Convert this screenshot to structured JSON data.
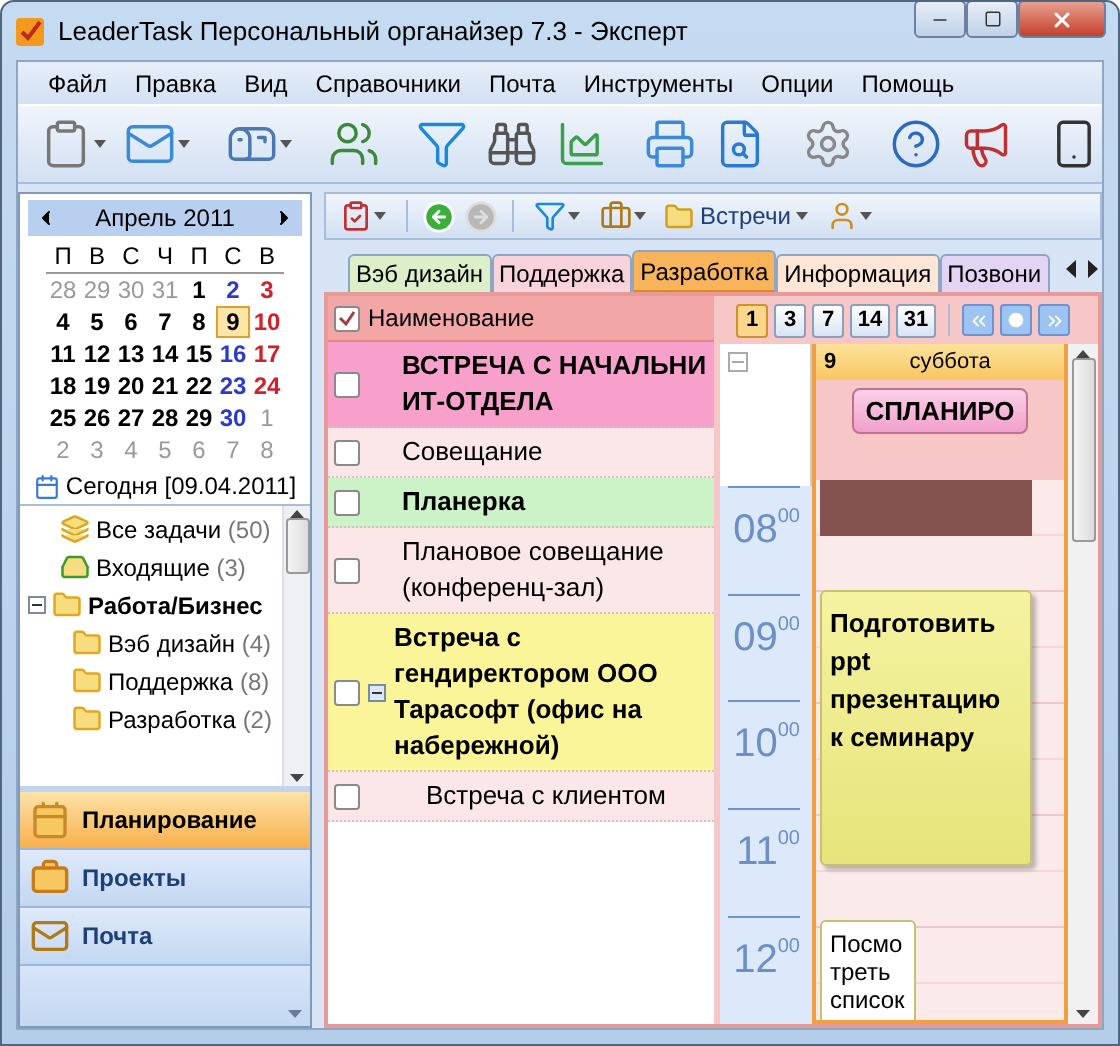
{
  "window": {
    "title": "LeaderTask Персональный органайзер 7.3 - Эксперт"
  },
  "menu": [
    "Файл",
    "Правка",
    "Вид",
    "Справочники",
    "Почта",
    "Инструменты",
    "Опции",
    "Помощь"
  ],
  "calendar": {
    "month": "Апрель 2011",
    "weekdays": [
      "П",
      "В",
      "С",
      "Ч",
      "П",
      "С",
      "В"
    ],
    "weeks": [
      [
        {
          "day": "28",
          "kind": "other",
          "selected": false
        },
        {
          "day": "29",
          "kind": "other",
          "selected": false
        },
        {
          "day": "30",
          "kind": "other",
          "selected": false
        },
        {
          "day": "31",
          "kind": "other",
          "selected": false
        },
        {
          "day": "1",
          "kind": "weekday",
          "selected": false
        },
        {
          "day": "2",
          "kind": "saturday",
          "selected": false
        },
        {
          "day": "3",
          "kind": "sunday",
          "selected": false
        }
      ],
      [
        {
          "day": "4",
          "kind": "weekday",
          "selected": false
        },
        {
          "day": "5",
          "kind": "weekday",
          "selected": false
        },
        {
          "day": "6",
          "kind": "weekday",
          "selected": false
        },
        {
          "day": "7",
          "kind": "weekday",
          "selected": false
        },
        {
          "day": "8",
          "kind": "weekday",
          "selected": false
        },
        {
          "day": "9",
          "kind": "saturday",
          "selected": true
        },
        {
          "day": "10",
          "kind": "sunday",
          "selected": false
        }
      ],
      [
        {
          "day": "11",
          "kind": "weekday",
          "selected": false
        },
        {
          "day": "12",
          "kind": "weekday",
          "selected": false
        },
        {
          "day": "13",
          "kind": "weekday",
          "selected": false
        },
        {
          "day": "14",
          "kind": "weekday",
          "selected": false
        },
        {
          "day": "15",
          "kind": "weekday",
          "selected": false
        },
        {
          "day": "16",
          "kind": "saturday",
          "selected": false
        },
        {
          "day": "17",
          "kind": "sunday",
          "selected": false
        }
      ],
      [
        {
          "day": "18",
          "kind": "weekday",
          "selected": false
        },
        {
          "day": "19",
          "kind": "weekday",
          "selected": false
        },
        {
          "day": "20",
          "kind": "weekday",
          "selected": false
        },
        {
          "day": "21",
          "kind": "weekday",
          "selected": false
        },
        {
          "day": "22",
          "kind": "weekday",
          "selected": false
        },
        {
          "day": "23",
          "kind": "saturday",
          "selected": false
        },
        {
          "day": "24",
          "kind": "sunday",
          "selected": false
        }
      ],
      [
        {
          "day": "25",
          "kind": "weekday",
          "selected": false
        },
        {
          "day": "26",
          "kind": "weekday",
          "selected": false
        },
        {
          "day": "27",
          "kind": "weekday",
          "selected": false
        },
        {
          "day": "28",
          "kind": "weekday",
          "selected": false
        },
        {
          "day": "29",
          "kind": "weekday",
          "selected": false
        },
        {
          "day": "30",
          "kind": "saturday",
          "selected": false
        },
        {
          "day": "1",
          "kind": "other",
          "selected": false
        }
      ],
      [
        {
          "day": "2",
          "kind": "other",
          "selected": false
        },
        {
          "day": "3",
          "kind": "other",
          "selected": false
        },
        {
          "day": "4",
          "kind": "other",
          "selected": false
        },
        {
          "day": "5",
          "kind": "other",
          "selected": false
        },
        {
          "day": "6",
          "kind": "other",
          "selected": false
        },
        {
          "day": "7",
          "kind": "other",
          "selected": false
        },
        {
          "day": "8",
          "kind": "other",
          "selected": false
        }
      ]
    ],
    "today": "Сегодня [09.04.2011]"
  },
  "tree": [
    {
      "label": "Все задачи",
      "count": "(50)",
      "kind": "all",
      "bold": false
    },
    {
      "label": "Входящие",
      "count": "(3)",
      "kind": "inbox",
      "bold": false
    },
    {
      "label": "Работа/Бизнес",
      "kind": "folder",
      "bold": true,
      "expanded": true,
      "children": [
        {
          "label": "Вэб дизайн",
          "count": "(4)",
          "kind": "folder",
          "bold": false
        },
        {
          "label": "Поддержка",
          "count": "(8)",
          "kind": "folder",
          "bold": false
        },
        {
          "label": "Разработка",
          "count": "(2)",
          "kind": "folder",
          "bold": false
        }
      ]
    }
  ],
  "nav": [
    {
      "label": "Планирование",
      "kind": "calendar",
      "selected": true
    },
    {
      "label": "Проекты",
      "kind": "briefcase",
      "selected": false
    },
    {
      "label": "Почта",
      "kind": "mail",
      "selected": false
    }
  ],
  "subtoolbar": {
    "filter_label": "Встречи"
  },
  "tabs": [
    {
      "label": "Вэб дизайн",
      "color": "#dcefc8",
      "selected": false
    },
    {
      "label": "Поддержка",
      "color": "#f9d3dc",
      "selected": false
    },
    {
      "label": "Разработка",
      "color": "#f8b45a",
      "selected": true
    },
    {
      "label": "Информация",
      "color": "#fde6d6",
      "selected": false
    },
    {
      "label": "Позвони",
      "color": "#e2d4f2",
      "selected": false
    }
  ],
  "tasks": {
    "header": {
      "label": "Наименование",
      "checked": true
    },
    "rows": [
      {
        "title": "ВСТРЕЧА С НАЧАЛЬНИ\nИТ-ОТДЕЛА",
        "color": "#f7a0cc",
        "bold": true,
        "checked": false
      },
      {
        "title": "Совещание",
        "color": "#fbe6e8",
        "bold": false,
        "checked": false
      },
      {
        "title": "Планерка",
        "color": "#ccf2c8",
        "bold": true,
        "checked": false
      },
      {
        "title": "Плановое совещание\n(конференц-зал)",
        "color": "#fbe6e8",
        "bold": false,
        "checked": false
      },
      {
        "title": "Встреча с\nгендиректором ООО\nТарасофт (офис на\nнабережной)",
        "color": "#fbf59a",
        "bold": true,
        "checked": false,
        "expanded": true,
        "children": [
          {
            "title": "Встреча с клиентом",
            "color": "#fbe6e8",
            "bold": false,
            "checked": false
          }
        ]
      }
    ]
  },
  "day_view": {
    "scales": [
      {
        "label": "1",
        "selected": true
      },
      {
        "label": "3",
        "selected": false
      },
      {
        "label": "7",
        "selected": false
      },
      {
        "label": "14",
        "selected": false
      },
      {
        "label": "31",
        "selected": false
      }
    ],
    "day": "9",
    "weekday": "суббота",
    "all_day": [
      {
        "title": "СПЛАНИРО"
      }
    ],
    "hours": [
      {
        "label": "08$^{00}$",
        "events": [
          {
            "kind": "busy",
            "color": "#84524f"
          }
        ]
      },
      {
        "label": "09$^{00}$",
        "events": [
          {
            "kind": "note",
            "color": "#f5f3a0",
            "title": "Подготовить\nppt\nпрезентацию\nк семинару"
          }
        ]
      },
      {
        "label": "10$^{00}$"
      },
      {
        "label": "11$^{00}$"
      },
      {
        "label": "12$^{00}$",
        "events": [
          {
            "kind": "plain",
            "color": "#ffffff",
            "title": "Посмо\nтреть\nсписок"
          }
        ]
      }
    ]
  }
}
